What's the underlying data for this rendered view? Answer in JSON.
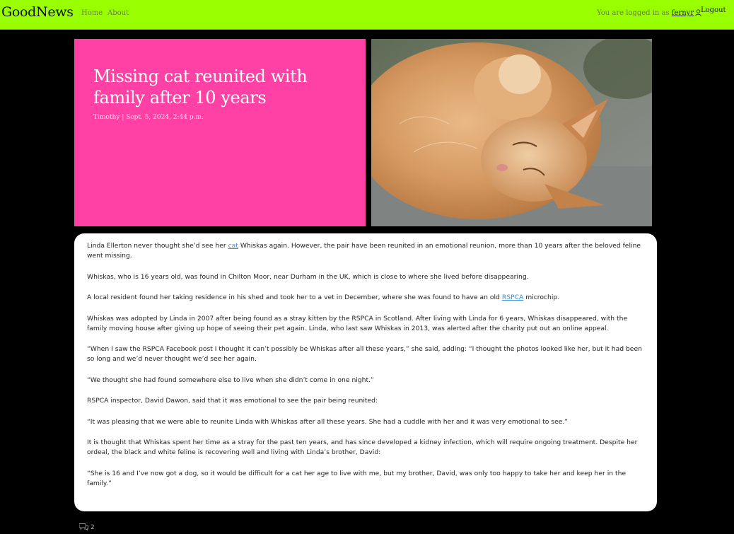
{
  "nav": {
    "brand": "GoodNews",
    "links": [
      "Home",
      "About"
    ],
    "logged_in_prefix": "You are logged in as",
    "username": "fernyr",
    "logout": "Logout",
    "accent": "#99ff00"
  },
  "hero": {
    "title": "Missing cat reunited with family after 10 years",
    "author": "Timothy",
    "separator": "|",
    "date": "Sept. 5, 2024, 2:44 p.m.",
    "background": "#ff40a4"
  },
  "article": {
    "paragraphs": [
      {
        "before": "Linda Ellerton never thought she’d see her ",
        "link": "cat",
        "after": " Whiskas again. However, the pair have been reunited in an emotional reunion, more than 10 years after the beloved feline went missing."
      },
      {
        "before": "Whiskas, who is 16 years old, was found in Chilton Moor, near Durham in the UK, which is close to where she lived before disappearing.",
        "link": "",
        "after": ""
      },
      {
        "before": "A local resident found her taking residence in his shed and took her to a vet in December, where she was found to have an old ",
        "link": "RSPCA",
        "after": " microchip."
      },
      {
        "before": "Whiskas was adopted by Linda in 2007 after being found as a stray kitten by the RSPCA in Scotland. After living with Linda for 6 years, Whiskas disappeared, with the family moving house after giving up hope of seeing their pet again. Linda, who last saw Whiskas in 2013, was alerted after the charity put out an online appeal.",
        "link": "",
        "after": ""
      },
      {
        "before": "“When I saw the RSPCA Facebook post I thought it can’t possibly be Whiskas after all these years,” she said, adding: “I thought the photos looked like her, but it had been so long and we’d never thought we’d see her again.",
        "link": "",
        "after": ""
      },
      {
        "before": "“We thought she had found somewhere else to live when she didn’t come in one night.”",
        "link": "",
        "after": ""
      },
      {
        "before": "RSPCA inspector, David Dawon, said that it was emotional to see the pair being reunited:",
        "link": "",
        "after": ""
      },
      {
        "before": "“It was pleasing that we were able to reunite Linda with Whiskas after all these years. She had a cuddle with her and it was very emotional to see.”",
        "link": "",
        "after": ""
      },
      {
        "before": "It is thought that Whiskas spent her time as a stray for the past ten years, and has since developed a kidney infection, which will require ongoing treatment. Despite her ordeal, the black and white feline is recovering well and living with Linda’s brother, David:",
        "link": "",
        "after": ""
      },
      {
        "before": "“She is 16 and I’ve now got a dog, so it would be difficult for a cat her age to live with me, but my brother, David, was only too happy to take her and keep her in the family.”",
        "link": "",
        "after": ""
      }
    ]
  },
  "comments": {
    "icon": "comments-icon",
    "count": "2"
  }
}
